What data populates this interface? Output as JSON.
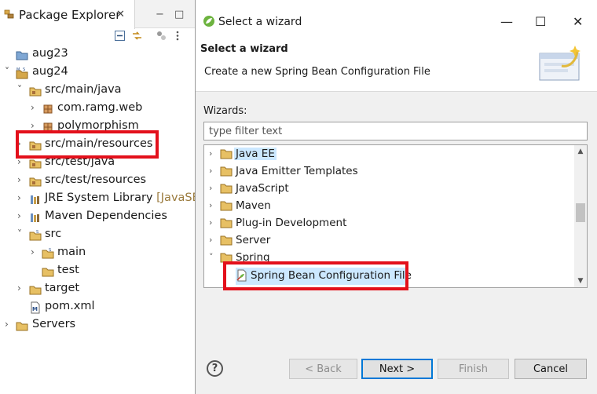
{
  "explorer": {
    "tab_label": "Package Explorer",
    "tab_close": "✕",
    "minimize": "−",
    "maximize": "□",
    "toolbar": [
      "collapse-all-icon",
      "link-with-editor-icon",
      "focus-icon",
      "view-menu-icon"
    ],
    "tree": [
      {
        "label": "aug23",
        "decor": "",
        "icon": "project-icon",
        "arrow": ""
      },
      {
        "label": "aug24",
        "decor": "",
        "icon": "maven-project-icon",
        "arrow": "˅"
      },
      {
        "label": "src/main/java",
        "decor": "",
        "icon": "source-folder-icon",
        "arrow": "˅"
      },
      {
        "label": "com.ramg.web",
        "decor": "",
        "icon": "package-icon",
        "arrow": "›"
      },
      {
        "label": "polymorphism",
        "decor": "",
        "icon": "package-icon",
        "arrow": "›"
      },
      {
        "label": "src/main/resources",
        "decor": "",
        "icon": "source-folder-icon",
        "arrow": "›"
      },
      {
        "label": "src/test/java",
        "decor": "",
        "icon": "source-folder-icon",
        "arrow": "›"
      },
      {
        "label": "src/test/resources",
        "decor": "",
        "icon": "source-folder-icon",
        "arrow": "›"
      },
      {
        "label": "JRE System Library",
        "decor": "[JavaSE-",
        "icon": "library-icon",
        "arrow": "›"
      },
      {
        "label": "Maven Dependencies",
        "decor": "",
        "icon": "library-icon",
        "arrow": "›"
      },
      {
        "label": "src",
        "decor": "",
        "icon": "folder-icon",
        "arrow": "˅"
      },
      {
        "label": "main",
        "decor": "",
        "icon": "folder-icon",
        "arrow": "›"
      },
      {
        "label": "test",
        "decor": "",
        "icon": "folder-icon",
        "arrow": ""
      },
      {
        "label": "target",
        "decor": "",
        "icon": "folder-icon",
        "arrow": "›"
      },
      {
        "label": "pom.xml",
        "decor": "",
        "icon": "xml-file-icon",
        "arrow": ""
      },
      {
        "label": "Servers",
        "decor": "",
        "icon": "folder-icon",
        "arrow": "›"
      }
    ]
  },
  "dialog": {
    "title": "Select a wizard",
    "minimize": "—",
    "maximize": "☐",
    "close": "✕",
    "header_title": "Select a wizard",
    "header_desc": "Create a new Spring Bean Configuration File",
    "wizards_label": "Wizards:",
    "filter_placeholder": "type filter text",
    "filter_value": "",
    "wizards": [
      {
        "label": "Java EE",
        "arrow": "›"
      },
      {
        "label": "Java Emitter Templates",
        "arrow": "›"
      },
      {
        "label": "JavaScript",
        "arrow": "›"
      },
      {
        "label": "Maven",
        "arrow": "›"
      },
      {
        "label": "Plug-in Development",
        "arrow": "›"
      },
      {
        "label": "Server",
        "arrow": "›"
      },
      {
        "label": "Spring",
        "arrow": "˅"
      }
    ],
    "selected_wizard": "Spring Bean Configuration File",
    "buttons": {
      "help": "?",
      "back": "< Back",
      "next": "Next >",
      "finish": "Finish",
      "cancel": "Cancel"
    }
  },
  "colors": {
    "highlight_box": "#e3101b",
    "selection": "#cce8ff",
    "default_button_border": "#0078d7"
  }
}
